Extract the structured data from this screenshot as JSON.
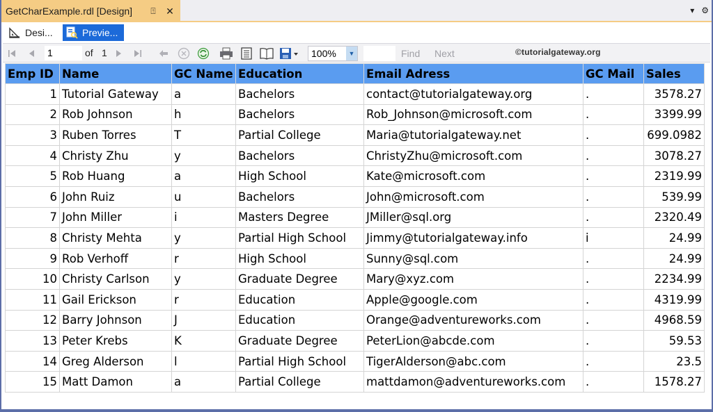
{
  "document_tab": {
    "title": "GetCharExample.rdl [Design]",
    "pin_glyph": "⍐",
    "close_glyph": "✕"
  },
  "strip_right": {
    "dropdown_glyph": "▾",
    "settings_glyph": "⚙"
  },
  "view_tabs": [
    {
      "label": "Desi...",
      "icon": "design-ruler-icon",
      "active": false
    },
    {
      "label": "Previe...",
      "icon": "preview-report-icon",
      "active": true
    }
  ],
  "toolbar": {
    "page_current": "1",
    "of_label": "of",
    "page_total": "1",
    "zoom": "100%",
    "find_label": "Find",
    "next_label": "Next",
    "watermark": "©tutorialgateway.org"
  },
  "colors": {
    "header_bg": "#5a9cf0",
    "active_tab_bg": "#1c6ad9",
    "document_tab_bg": "#f5cc84",
    "frame": "#5c6ea8"
  },
  "table": {
    "columns": [
      "Emp ID",
      "Name",
      "GC Name",
      "Education",
      "Email Adress",
      "GC  Mail",
      "Sales"
    ],
    "rows": [
      [
        "1",
        "Tutorial Gateway",
        "a",
        "Bachelors",
        "contact@tutorialgateway.org",
        ".",
        "3578.27"
      ],
      [
        "2",
        "Rob Johnson",
        "h",
        "Bachelors",
        "Rob_Johnson@microsoft.com",
        ".",
        "3399.99"
      ],
      [
        "3",
        "Ruben Torres",
        "T",
        "Partial College",
        "Maria@tutorialgateway.net",
        ".",
        "699.0982"
      ],
      [
        "4",
        "Christy Zhu",
        "y",
        "Bachelors",
        "ChristyZhu@microsoft.com",
        ".",
        "3078.27"
      ],
      [
        "5",
        "Rob Huang",
        "a",
        "High School",
        "Kate@microsoft.com",
        ".",
        "2319.99"
      ],
      [
        "6",
        "John Ruiz",
        "u",
        "Bachelors",
        "John@microsoft.com",
        ".",
        "539.99"
      ],
      [
        "7",
        "John Miller",
        "i",
        "Masters Degree",
        "JMiller@sql.org",
        ".",
        "2320.49"
      ],
      [
        "8",
        "Christy Mehta",
        "y",
        "Partial High School",
        "Jimmy@tutorialgateway.info",
        "i",
        "24.99"
      ],
      [
        "9",
        "Rob Verhoff",
        "r",
        "High School",
        "Sunny@sql.com",
        ".",
        "24.99"
      ],
      [
        "10",
        "Christy Carlson",
        "y",
        "Graduate Degree",
        "Mary@xyz.com",
        ".",
        "2234.99"
      ],
      [
        "11",
        "Gail Erickson",
        "r",
        "Education",
        "Apple@google.com",
        ".",
        "4319.99"
      ],
      [
        "12",
        "Barry Johnson",
        "J",
        "Education",
        "Orange@adventureworks.com",
        ".",
        "4968.59"
      ],
      [
        "13",
        "Peter Krebs",
        "K",
        "Graduate Degree",
        "PeterLion@abcde.com",
        ".",
        "59.53"
      ],
      [
        "14",
        "Greg Alderson",
        "l",
        "Partial High School",
        "TigerAlderson@abc.com",
        ".",
        "23.5"
      ],
      [
        "15",
        "Matt Damon",
        "a",
        "Partial College",
        "mattdamon@adventureworks.com",
        ".",
        "1578.27"
      ]
    ]
  }
}
